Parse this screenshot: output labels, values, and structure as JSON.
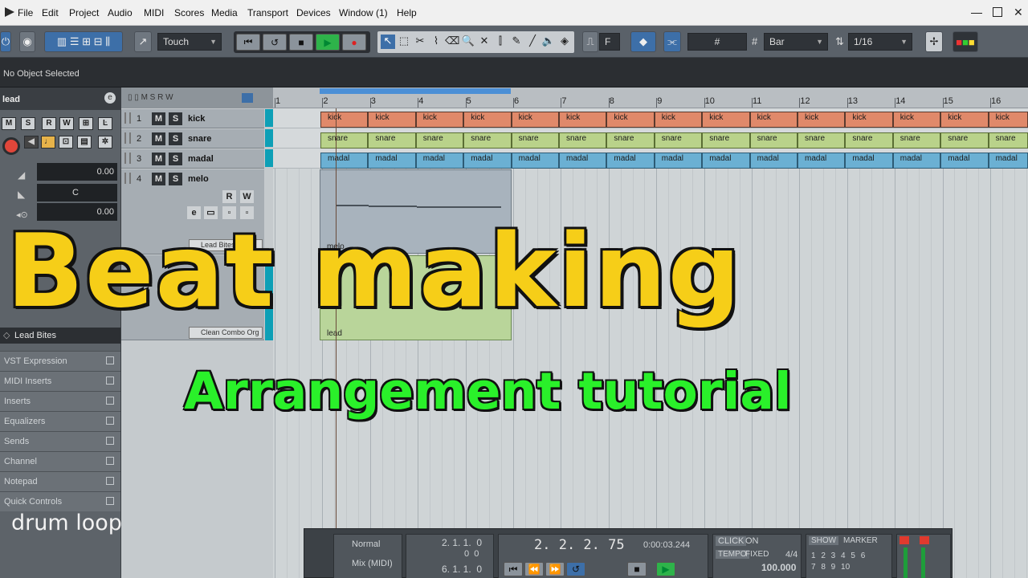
{
  "menu": {
    "items": [
      "File",
      "Edit",
      "Project",
      "Audio",
      "MIDI",
      "Scores",
      "Media",
      "Transport",
      "Devices",
      "Window (1)",
      "Help"
    ]
  },
  "toolbar": {
    "automation_mode": "Touch",
    "snap_type": "Bar",
    "quantize": "1/16",
    "grid_letter": "F"
  },
  "info_line": {
    "text": "No Object Selected"
  },
  "inspector": {
    "track_name": "lead",
    "volume": "0.00",
    "pan": "C",
    "delay": "0.00",
    "instrument": "Lead Bites",
    "sections": [
      "VST Expression",
      "MIDI Inserts",
      "Inserts",
      "Equalizers",
      "Sends",
      "Channel",
      "Notepad",
      "Quick Controls"
    ]
  },
  "tracks": [
    {
      "num": "1",
      "name": "kick"
    },
    {
      "num": "2",
      "name": "snare"
    },
    {
      "num": "3",
      "name": "madal"
    },
    {
      "num": "4",
      "name": "melo"
    }
  ],
  "track_extra": {
    "melo_instrument": "Lead Bites",
    "lead_instrument": "Clean Combo Org"
  },
  "ruler": {
    "bars": [
      "1",
      "2",
      "3",
      "4",
      "5",
      "6",
      "7",
      "8",
      "9",
      "10",
      "11",
      "12",
      "13",
      "14",
      "15",
      "16"
    ]
  },
  "events": {
    "kick_label": "kick",
    "snare_label": "snare",
    "madal_label": "madal",
    "melo_part": "melo",
    "lead_part": "lead"
  },
  "transport": {
    "mode1": "Normal",
    "mode2": "Mix (MIDI)",
    "left_locator": "2. 1. 1.  0",
    "left_locator_sub": "0  0",
    "right_locator": "6. 1. 1.  0",
    "position_bars": "2. 2. 2. 75",
    "position_time": "0:00:03.244",
    "click_label": "CLICK",
    "click_state": "ON",
    "tempo_label": "TEMPO",
    "tempo_mode": "FIXED",
    "signature": "4/4",
    "tempo": "100.000",
    "show_label": "SHOW",
    "marker_label": "MARKER",
    "marker_nums": "1 2 3 4 5 6 7 8 9 10"
  },
  "overlay": {
    "title": "Beat making",
    "subtitle": "Arrangement tutorial",
    "caption": "drum loop"
  },
  "colors": {
    "kick": "#e0896a",
    "snare": "#b9d28a",
    "madal": "#6bb0d3",
    "title": "#f6ce18",
    "subtitle": "#2af02a"
  }
}
